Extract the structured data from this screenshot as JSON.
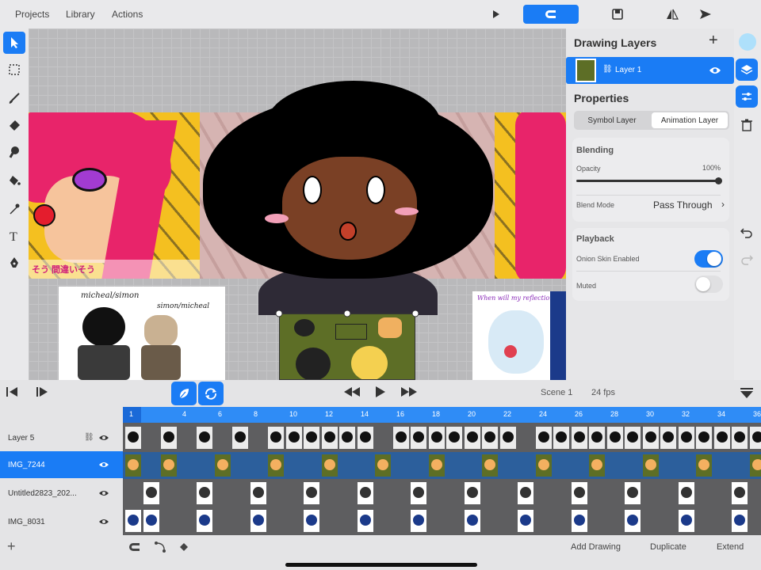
{
  "menu": {
    "projects": "Projects",
    "library": "Library",
    "actions": "Actions"
  },
  "layers_panel": {
    "title": "Drawing Layers",
    "add_symbol": "+",
    "selected_layer": "Layer 1"
  },
  "properties": {
    "title": "Properties",
    "tabs": [
      "Symbol Layer",
      "Animation Layer"
    ],
    "selected_tab": "Animation Layer",
    "blending": {
      "title": "Blending",
      "opacity_label": "Opacity",
      "opacity_value": "100%",
      "opacity_fraction": 1.0,
      "blend_mode_label": "Blend Mode",
      "blend_mode_value": "Pass Through"
    },
    "playback": {
      "title": "Playback",
      "onion_skin_label": "Onion Skin Enabled",
      "onion_skin_on": true,
      "muted_label": "Muted",
      "muted_on": false
    }
  },
  "transport": {
    "scene": "Scene 1",
    "fps": "24 fps"
  },
  "timeline": {
    "frame_numbers": [
      "1",
      "4",
      "6",
      "8",
      "10",
      "12",
      "14",
      "16",
      "18",
      "20",
      "22",
      "24",
      "26",
      "28",
      "30",
      "32",
      "34",
      "36"
    ],
    "layers": [
      "Layer 5",
      "IMG_7244",
      "Untitled2823_202...",
      "IMG_8031"
    ],
    "selected_layer": "IMG_7244"
  },
  "canvas_text": {
    "sticker1": "micheal/simon",
    "sticker2": "simon/micheal",
    "sticker3": "When will my reflection",
    "jp": "そう 間違いそう"
  },
  "bottom": {
    "add": "+",
    "add_drawing": "Add Drawing",
    "duplicate": "Duplicate",
    "extend": "Extend"
  },
  "colors": {
    "accent": "#1a7cf5",
    "current_color": "#aee0fb"
  }
}
